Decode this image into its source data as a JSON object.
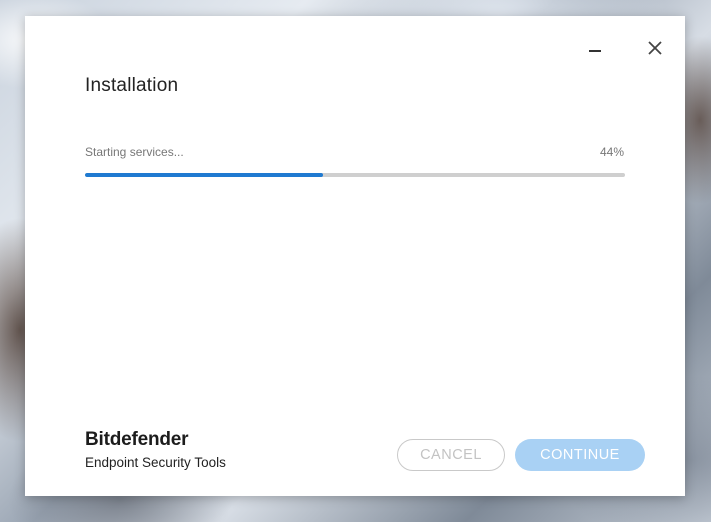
{
  "dialog": {
    "title": "Installation",
    "status_text": "Starting services...",
    "progress_percent_label": "44%",
    "progress_value": 0.44,
    "brand_name": "Bitdefender",
    "product_name": "Endpoint Security Tools"
  },
  "buttons": {
    "cancel_label": "CANCEL",
    "continue_label": "CONTINUE"
  },
  "icons": {
    "minimize": "minimize-icon",
    "close": "close-icon"
  },
  "colors": {
    "progress_fill": "#1f7ad1",
    "progress_track": "#cfcfcf",
    "continue_button_disabled": "#a9d1f4"
  }
}
